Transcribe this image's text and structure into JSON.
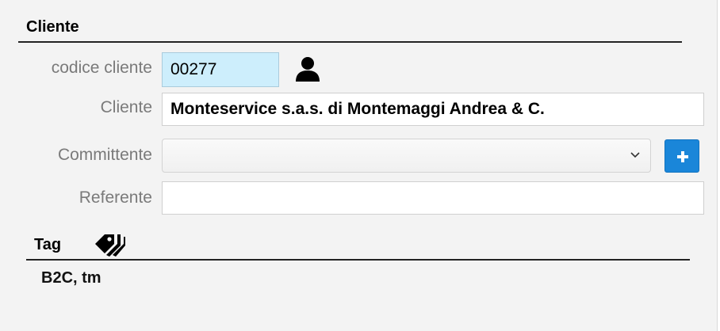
{
  "cliente_section": {
    "title": "Cliente",
    "codice_label": "codice cliente",
    "codice_value": "00277",
    "cliente_label": "Cliente",
    "cliente_value": "Monteservice s.a.s. di Montemaggi Andrea & C.",
    "committente_label": "Committente",
    "committente_value": "",
    "referente_label": "Referente",
    "referente_value": ""
  },
  "tag_section": {
    "title": "Tag",
    "value": "B2C, tm"
  },
  "icons": {
    "user": "user-icon",
    "tags": "tags-icon",
    "add": "plus-icon",
    "dropdown": "chevron-down-icon"
  },
  "colors": {
    "code_field_bg": "#cdeefc",
    "add_button": "#1a86d9"
  }
}
